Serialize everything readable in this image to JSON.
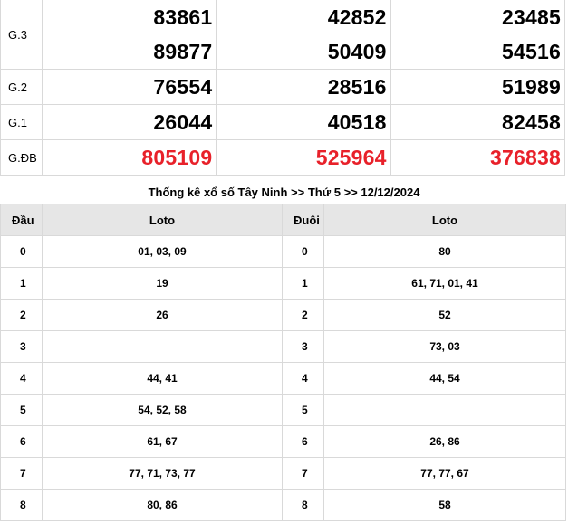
{
  "results": {
    "rows": [
      {
        "prize": "G.3",
        "special": false,
        "cols": [
          [
            "83861",
            "89877"
          ],
          [
            "42852",
            "50409"
          ],
          [
            "23485",
            "54516"
          ]
        ]
      },
      {
        "prize": "G.2",
        "special": false,
        "cols": [
          [
            "76554"
          ],
          [
            "28516"
          ],
          [
            "51989"
          ]
        ]
      },
      {
        "prize": "G.1",
        "special": false,
        "cols": [
          [
            "26044"
          ],
          [
            "40518"
          ],
          [
            "82458"
          ]
        ]
      },
      {
        "prize": "G.ĐB",
        "special": true,
        "cols": [
          [
            "805109"
          ],
          [
            "525964"
          ],
          [
            "376838"
          ]
        ]
      }
    ]
  },
  "stats": {
    "title": "Thống kê xổ số Tây Ninh >> Thứ 5 >> 12/12/2024",
    "headers": {
      "dau": "Đầu",
      "loto_left": "Loto",
      "duoi": "Đuôi",
      "loto_right": "Loto"
    },
    "rows": [
      {
        "dau": "0",
        "dau_loto": "01, 03, 09",
        "duoi": "0",
        "duoi_loto": "80"
      },
      {
        "dau": "1",
        "dau_loto": "19",
        "duoi": "1",
        "duoi_loto": "61, 71, 01, 41"
      },
      {
        "dau": "2",
        "dau_loto": "26",
        "duoi": "2",
        "duoi_loto": "52"
      },
      {
        "dau": "3",
        "dau_loto": "",
        "duoi": "3",
        "duoi_loto": "73, 03"
      },
      {
        "dau": "4",
        "dau_loto": "44, 41",
        "duoi": "4",
        "duoi_loto": "44, 54"
      },
      {
        "dau": "5",
        "dau_loto": "54, 52, 58",
        "duoi": "5",
        "duoi_loto": ""
      },
      {
        "dau": "6",
        "dau_loto": "61, 67",
        "duoi": "6",
        "duoi_loto": "26, 86"
      },
      {
        "dau": "7",
        "dau_loto": "77, 71, 73, 77",
        "duoi": "7",
        "duoi_loto": "77, 77, 67"
      },
      {
        "dau": "8",
        "dau_loto": "80, 86",
        "duoi": "8",
        "duoi_loto": "58"
      }
    ]
  },
  "colors": {
    "special_prize": "#e8212a",
    "header_bg": "#e6e6e6",
    "border": "#d9d9d9"
  }
}
